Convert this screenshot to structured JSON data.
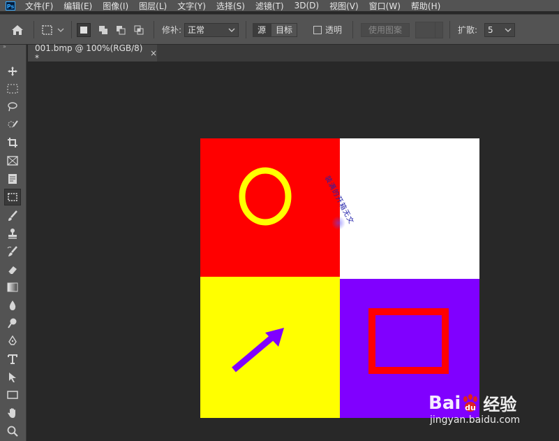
{
  "app": {
    "logo": "Ps"
  },
  "menu": [
    "文件(F)",
    "编辑(E)",
    "图像(I)",
    "图层(L)",
    "文字(Y)",
    "选择(S)",
    "滤镜(T)",
    "3D(D)",
    "视图(V)",
    "窗口(W)",
    "帮助(H)"
  ],
  "options": {
    "patch_label": "修补:",
    "patch_value": "正常",
    "source_label": "源",
    "target_label": "目标",
    "transparent_label": "透明",
    "use_pattern_label": "使用图案",
    "diffusion_label": "扩散:",
    "diffusion_value": "5"
  },
  "document": {
    "tab_title": "001.bmp @ 100%(RGB/8) *",
    "close_glyph": "×",
    "rotated_text": "装满的开箱无文"
  },
  "watermark": {
    "brand_latin_1": "Bai",
    "brand_latin_2": "u",
    "brand_chinese": "经验",
    "url": "jingyan.baidu.com"
  },
  "colors": {
    "red": "#ff0000",
    "yellow": "#ffff00",
    "purple": "#8000ff",
    "white": "#ffffff",
    "accent": "#31a8ff"
  }
}
